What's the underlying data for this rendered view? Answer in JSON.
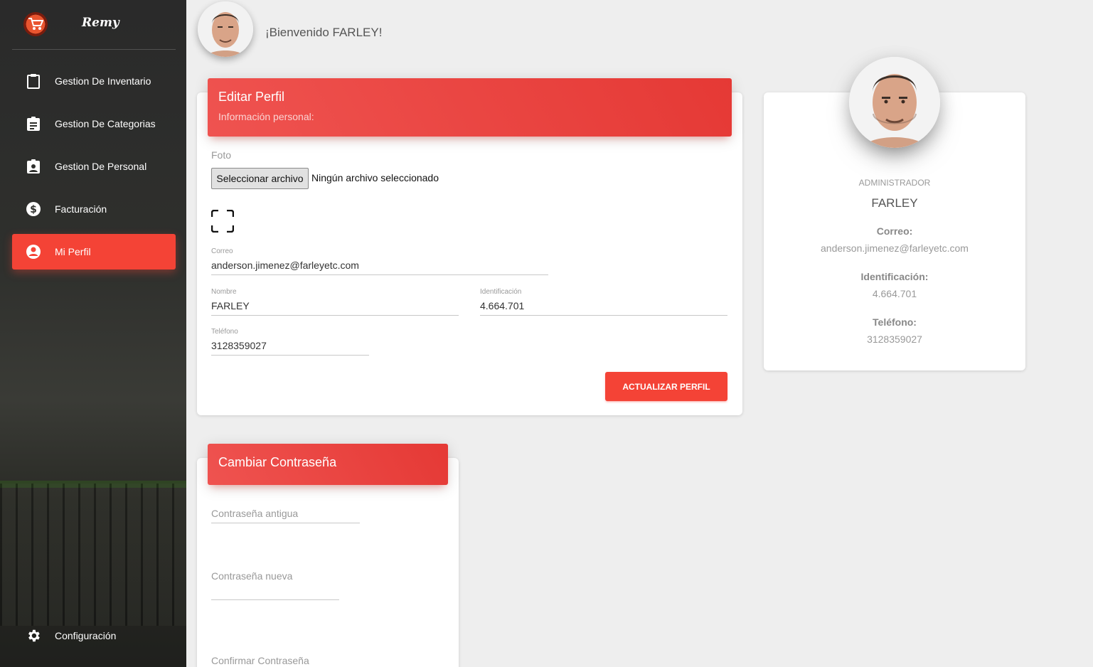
{
  "app": {
    "logo_text": "Remy"
  },
  "sidebar": {
    "items": [
      {
        "label": "Gestion De Inventario",
        "icon": "clipboard-icon"
      },
      {
        "label": "Gestion De Categorias",
        "icon": "assignment-icon"
      },
      {
        "label": "Gestion De Personal",
        "icon": "assignment-ind-icon"
      },
      {
        "label": "Facturación",
        "icon": "dollar-circle-icon"
      },
      {
        "label": "Mi Perfil",
        "icon": "account-circle-icon",
        "active": true
      }
    ],
    "settings_label": "Configuración"
  },
  "header": {
    "welcome": "¡Bienvenido FARLEY!"
  },
  "edit_profile": {
    "title": "Editar Perfil",
    "subtitle": "Información personal:",
    "photo_label": "Foto",
    "file_button": "Seleccionar archivo",
    "file_status": "Ningún archivo seleccionado",
    "email_label": "Correo",
    "email_value": "anderson.jimenez@farleyetc.com",
    "name_label": "Nombre",
    "name_value": "FARLEY",
    "id_label": "Identificación",
    "id_value": "4.664.701",
    "phone_label": "Teléfono",
    "phone_value": "3128359027",
    "update_button": "ACTUALIZAR PERFIL"
  },
  "change_password": {
    "title": "Cambiar Contraseña",
    "old_placeholder": "Contraseña antigua",
    "new_placeholder": "Contraseña nueva",
    "confirm_placeholder": "Confirmar Contraseña"
  },
  "profile_card": {
    "role": "ADMINISTRADOR",
    "name": "FARLEY",
    "email_key": "Correo:",
    "email_value": "anderson.jimenez@farleyetc.com",
    "id_key": "Identificación:",
    "id_value": "4.664.701",
    "phone_key": "Teléfono:",
    "phone_value": "3128359027"
  },
  "colors": {
    "accent": "#f44336",
    "sidebar_bg": "#2f302d",
    "page_bg": "#eeeeee"
  }
}
